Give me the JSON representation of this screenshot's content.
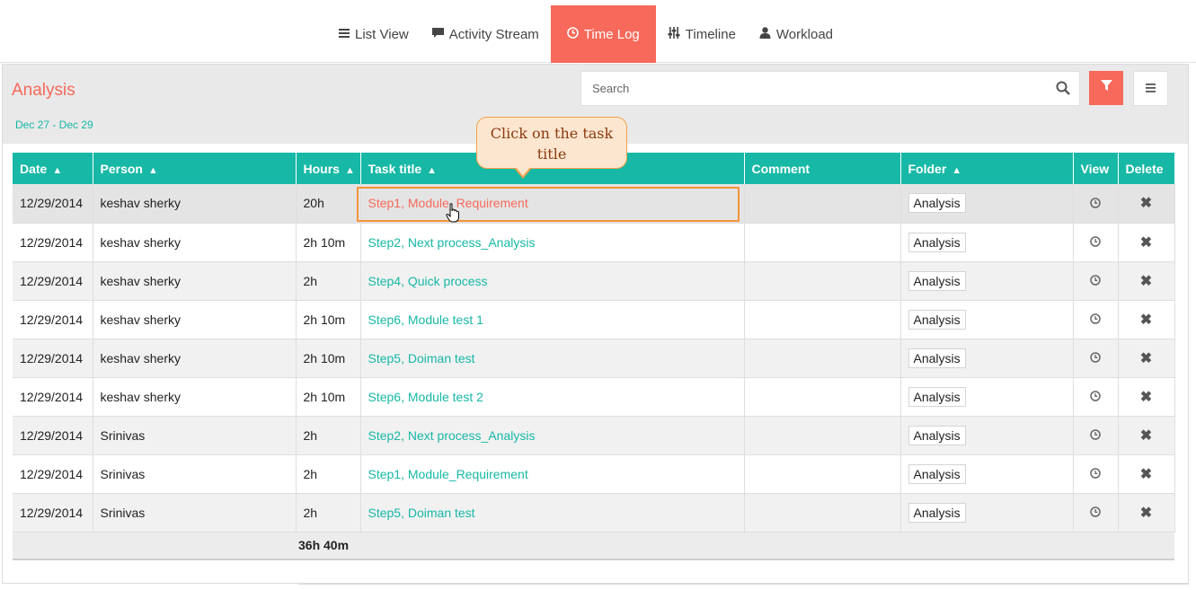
{
  "tabs": [
    {
      "label": "List View",
      "icon": "list-icon"
    },
    {
      "label": "Activity Stream",
      "icon": "comment-icon"
    },
    {
      "label": "Time Log",
      "icon": "clock-icon",
      "active": true
    },
    {
      "label": "Timeline",
      "icon": "sliders-icon"
    },
    {
      "label": "Workload",
      "icon": "user-icon"
    }
  ],
  "panel": {
    "title": "Analysis",
    "date_range": "Dec 27  -  Dec 29",
    "search_placeholder": "Search"
  },
  "table": {
    "headers": [
      "Date",
      "Person",
      "Hours",
      "Task title",
      "Comment",
      "Folder",
      "View",
      "Delete"
    ],
    "rows": [
      {
        "date": "12/29/2014",
        "person": "keshav sherky",
        "hours": "20h",
        "task": "Step1, Module_Requirement",
        "comment": "",
        "folder": "Analysis"
      },
      {
        "date": "12/29/2014",
        "person": "keshav sherky",
        "hours": "2h 10m",
        "task": "Step2, Next process_Analysis",
        "comment": "",
        "folder": "Analysis"
      },
      {
        "date": "12/29/2014",
        "person": "keshav sherky",
        "hours": "2h",
        "task": "Step4, Quick process",
        "comment": "",
        "folder": "Analysis"
      },
      {
        "date": "12/29/2014",
        "person": "keshav sherky",
        "hours": "2h 10m",
        "task": "Step6, Module test 1",
        "comment": "",
        "folder": "Analysis"
      },
      {
        "date": "12/29/2014",
        "person": "keshav sherky",
        "hours": "2h 10m",
        "task": "Step5, Doiman test",
        "comment": "",
        "folder": "Analysis"
      },
      {
        "date": "12/29/2014",
        "person": "keshav sherky",
        "hours": "2h 10m",
        "task": "Step6, Module test 2",
        "comment": "",
        "folder": "Analysis"
      },
      {
        "date": "12/29/2014",
        "person": "Srinivas",
        "hours": "2h",
        "task": "Step2, Next process_Analysis",
        "comment": "",
        "folder": "Analysis"
      },
      {
        "date": "12/29/2014",
        "person": "Srinivas",
        "hours": "2h",
        "task": "Step1, Module_Requirement",
        "comment": "",
        "folder": "Analysis"
      },
      {
        "date": "12/29/2014",
        "person": "Srinivas",
        "hours": "2h",
        "task": "Step5, Doiman test",
        "comment": "",
        "folder": "Analysis"
      }
    ],
    "total_hours": "36h 40m",
    "delete_symbol": "✖"
  },
  "callout": {
    "text": "Click on the task title"
  },
  "colors": {
    "accent": "#f7695a",
    "teal": "#17b8a6",
    "highlight_border": "#f4943a"
  }
}
